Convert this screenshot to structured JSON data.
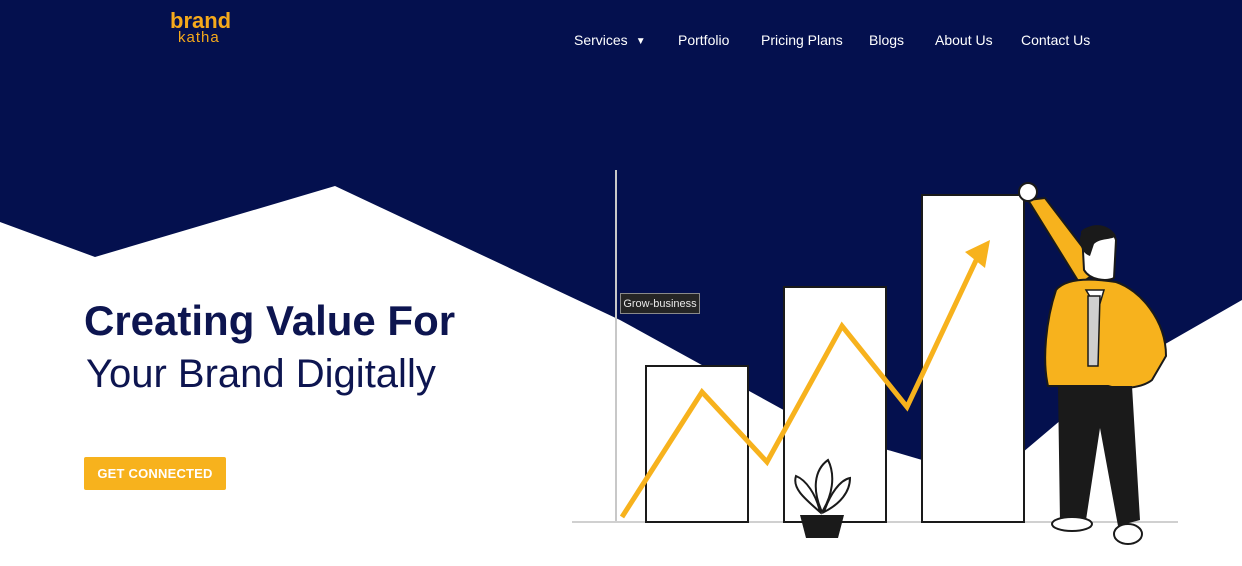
{
  "logo": {
    "line1": "brand",
    "line2": "katha"
  },
  "nav": {
    "items": [
      {
        "label": "Services",
        "has_dropdown": true
      },
      {
        "label": "Portfolio"
      },
      {
        "label": "Pricing Plans"
      },
      {
        "label": "Blogs"
      },
      {
        "label": "About Us"
      },
      {
        "label": "Contact Us"
      }
    ]
  },
  "hero": {
    "title_line1": "Creating Value For",
    "title_line2": "Your Brand Digitally",
    "cta_label": "GET CONNECTED"
  },
  "illustration": {
    "tooltip": "Grow-business"
  },
  "colors": {
    "navy": "#04104e",
    "accent": "#f7b21d",
    "text_dark": "#0d1550"
  }
}
